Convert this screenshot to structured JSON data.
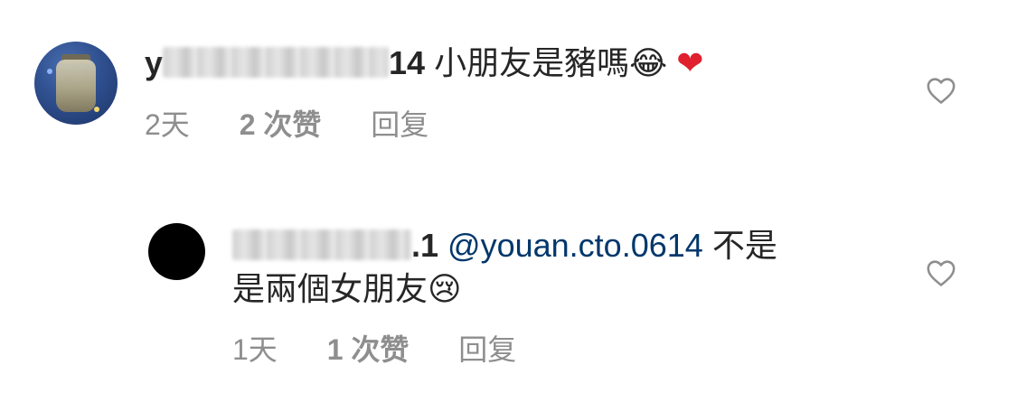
{
  "comments": [
    {
      "username_visible": "y",
      "username_suffix": "14",
      "text": "小朋友是豬嗎",
      "emoji_1": "😂",
      "emoji_2": "❤",
      "time": "2天",
      "likes": "2 次赞",
      "reply_label": "回复"
    },
    {
      "username_suffix": ".1",
      "mention": "@youan.cto.0614",
      "text_line1": "不是",
      "text_line2": "是兩個女朋友",
      "emoji": "😢",
      "time": "1天",
      "likes": "1 次赞",
      "reply_label": "回复"
    }
  ],
  "icons": {
    "like": "heart-outline-icon"
  },
  "colors": {
    "text": "#262626",
    "meta": "#8e8e8e",
    "mention": "#00376b"
  }
}
